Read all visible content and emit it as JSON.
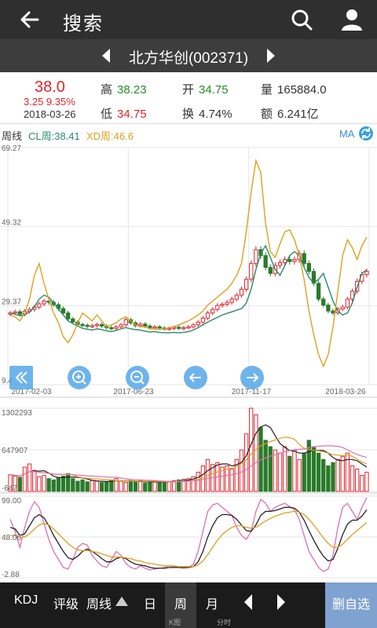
{
  "header": {
    "title": "搜索"
  },
  "stock": {
    "name": "北方华创(002371)"
  },
  "quote": {
    "price": "38.0",
    "change": "3.25 9.35%",
    "date": "2018-03-26",
    "high_label": "高",
    "high": "38.23",
    "open_label": "开",
    "open": "34.75",
    "volume_label": "量",
    "volume": "165884.0",
    "low_label": "低",
    "low": "34.75",
    "turnover_label": "换",
    "turnover": "4.74%",
    "amount_label": "额",
    "amount": "6.241亿"
  },
  "indicator": {
    "period": "周线",
    "cl": "CL周:38.41",
    "xd": "XD周:46.6",
    "ma": "MA"
  },
  "colors": {
    "up": "#e0252c",
    "down": "#2a7a2a",
    "cl": "#2a8a6a",
    "xd": "#e0a020",
    "pink": "#e070b0"
  },
  "chart_data": [
    {
      "type": "candlestick",
      "title": "",
      "ylabels": [
        "69.27",
        "49.32",
        "29.37",
        "9.4"
      ],
      "ylim": [
        9.4,
        69.27
      ],
      "xlabels": [
        "2017-02-03",
        "2017-06-23",
        "2017-11-17",
        "2018-03-26"
      ],
      "close": [
        27.5,
        27.8,
        27.2,
        27.9,
        28.4,
        29.0,
        29.8,
        30.5,
        30.2,
        29.6,
        28.6,
        27.5,
        26.0,
        25.2,
        24.6,
        24.4,
        24.1,
        24.3,
        24.6,
        24.2,
        23.8,
        23.6,
        24.0,
        24.5,
        25.8,
        25.0,
        24.3,
        24.7,
        24.2,
        23.8,
        24.0,
        23.7,
        23.5,
        23.6,
        23.9,
        23.6,
        23.8,
        24.0,
        24.5,
        25.2,
        26.2,
        27.5,
        28.4,
        29.4,
        29.7,
        30.2,
        31.0,
        32.0,
        33.5,
        36.0,
        40.0,
        43.5,
        42.0,
        39.0,
        37.5,
        39.5,
        40.2,
        41.0,
        40.5,
        41.0,
        42.5,
        40.0,
        38.0,
        35.0,
        31.0,
        29.5,
        28.0,
        27.5,
        28.5,
        29.0,
        31.0,
        33.0,
        35.5,
        37.2,
        38.0
      ],
      "series": [
        {
          "name": "CL周",
          "values": [
            27.5,
            27.2,
            26.8,
            27.0,
            27.8,
            29.0,
            31.0,
            32.0,
            31.5,
            30.0,
            28.5,
            27.0,
            25.5,
            24.8,
            24.2,
            23.6,
            23.4,
            23.2,
            23.5,
            23.3,
            23.0,
            22.8,
            23.1,
            23.5,
            23.8,
            23.5,
            23.3,
            23.2,
            22.9,
            22.7,
            22.8,
            22.6,
            22.5,
            22.5,
            22.6,
            22.5,
            22.6,
            22.8,
            23.2,
            23.8,
            24.5,
            25.2,
            25.8,
            26.4,
            27.0,
            27.4,
            27.8,
            28.2,
            28.6,
            30.0,
            33.5,
            38.5,
            42.5,
            44.5,
            41.5,
            38.5,
            37.0,
            39.5,
            42.0,
            43.0,
            42.0,
            39.0,
            36.5,
            35.0,
            36.0,
            37.5,
            34.0,
            30.5,
            28.0,
            27.0,
            27.5,
            30.0,
            34.0,
            37.5,
            38.4
          ]
        },
        {
          "name": "XD周",
          "values": [
            27.0,
            26.5,
            25.5,
            27.5,
            31.0,
            37.0,
            40.0,
            35.0,
            31.0,
            27.5,
            25.0,
            21.5,
            20.0,
            22.0,
            25.0,
            27.5,
            26.5,
            25.5,
            27.0,
            25.5,
            24.0,
            24.5,
            25.0,
            26.0,
            26.5,
            25.5,
            24.5,
            24.0,
            24.0,
            23.5,
            23.5,
            23.3,
            23.5,
            23.8,
            24.0,
            24.5,
            25.0,
            25.5,
            26.2,
            27.0,
            28.0,
            29.5,
            30.5,
            31.5,
            32.5,
            33.5,
            35.0,
            37.0,
            40.0,
            48.0,
            58.0,
            66.0,
            63.0,
            50.0,
            43.0,
            41.5,
            45.0,
            48.0,
            48.5,
            46.0,
            42.0,
            36.0,
            28.0,
            22.0,
            17.0,
            14.0,
            17.0,
            24.0,
            33.0,
            42.0,
            46.0,
            44.0,
            41.0,
            44.5,
            46.6
          ]
        }
      ]
    },
    {
      "type": "bar",
      "title": "",
      "ylabels": [
        "1302293",
        "647907",
        "-647"
      ],
      "values": [
        260000,
        240000,
        220000,
        380000,
        430000,
        330000,
        230000,
        250000,
        200000,
        180000,
        220000,
        240000,
        280000,
        200000,
        160000,
        180000,
        150000,
        170000,
        160000,
        140000,
        150000,
        180000,
        200000,
        160000,
        140000,
        160000,
        150000,
        170000,
        130000,
        150000,
        150000,
        140000,
        160000,
        150000,
        170000,
        180000,
        190000,
        200000,
        230000,
        300000,
        400000,
        500000,
        420000,
        450000,
        380000,
        400000,
        350000,
        500000,
        650000,
        900000,
        1302293,
        1200000,
        1000000,
        800000,
        700000,
        650000,
        600000,
        700000,
        550000,
        650000,
        500000,
        600000,
        800000,
        700000,
        600000,
        500000,
        400000,
        450000,
        500000,
        550000,
        600000,
        400000,
        350000,
        250000,
        300000
      ]
    },
    {
      "type": "line",
      "title": "",
      "ylabels": [
        "99.00",
        "48.06",
        "-2.88"
      ],
      "ylim": [
        -2.88,
        99.0
      ],
      "series": [
        {
          "name": "",
          "values": [
            70,
            55,
            35,
            60,
            80,
            92,
            85,
            65,
            45,
            30,
            20,
            10,
            8,
            20,
            35,
            40,
            38,
            25,
            18,
            12,
            10,
            20,
            30,
            25,
            15,
            10,
            8,
            12,
            9,
            7,
            8,
            9,
            10,
            12,
            11,
            10,
            9,
            10,
            14,
            30,
            55,
            80,
            88,
            90,
            85,
            80,
            75,
            60,
            50,
            45,
            55,
            80,
            95,
            90,
            80,
            85,
            88,
            90,
            86,
            82,
            70,
            50,
            30,
            20,
            10,
            5,
            8,
            25,
            60,
            85,
            90,
            80,
            70,
            85,
            97
          ]
        },
        {
          "name": "",
          "values": [
            60,
            58,
            50,
            52,
            62,
            72,
            76,
            72,
            62,
            50,
            40,
            30,
            22,
            20,
            24,
            30,
            33,
            30,
            26,
            21,
            17,
            17,
            21,
            23,
            21,
            17,
            14,
            13,
            12,
            10,
            9,
            9,
            9,
            10,
            10,
            10,
            10,
            10,
            11,
            17,
            30,
            48,
            62,
            72,
            76,
            76,
            75,
            70,
            63,
            56,
            55,
            63,
            75,
            80,
            80,
            81,
            83,
            85,
            85,
            84,
            79,
            69,
            56,
            44,
            33,
            24,
            18,
            20,
            34,
            51,
            64,
            69,
            69,
            74,
            82
          ]
        },
        {
          "name": "",
          "values": [
            50,
            50,
            48,
            48,
            52,
            58,
            63,
            65,
            63,
            58,
            52,
            46,
            40,
            35,
            32,
            31,
            31,
            30,
            29,
            27,
            25,
            23,
            23,
            23,
            22,
            21,
            19,
            18,
            16,
            15,
            14,
            13,
            12,
            12,
            12,
            11,
            11,
            11,
            11,
            13,
            18,
            26,
            35,
            44,
            51,
            56,
            60,
            62,
            62,
            60,
            59,
            60,
            64,
            68,
            71,
            74,
            76,
            78,
            79,
            80,
            79,
            76,
            70,
            63,
            55,
            47,
            40,
            35,
            35,
            39,
            45,
            51,
            56,
            61,
            66
          ]
        }
      ]
    }
  ],
  "footer": {
    "kdj": "KDJ",
    "rating": "评级",
    "weekly": "周线",
    "day": "日",
    "week": "周",
    "month": "月",
    "sub_k": "K图",
    "sub_fen": "分时",
    "add": "删自选"
  }
}
